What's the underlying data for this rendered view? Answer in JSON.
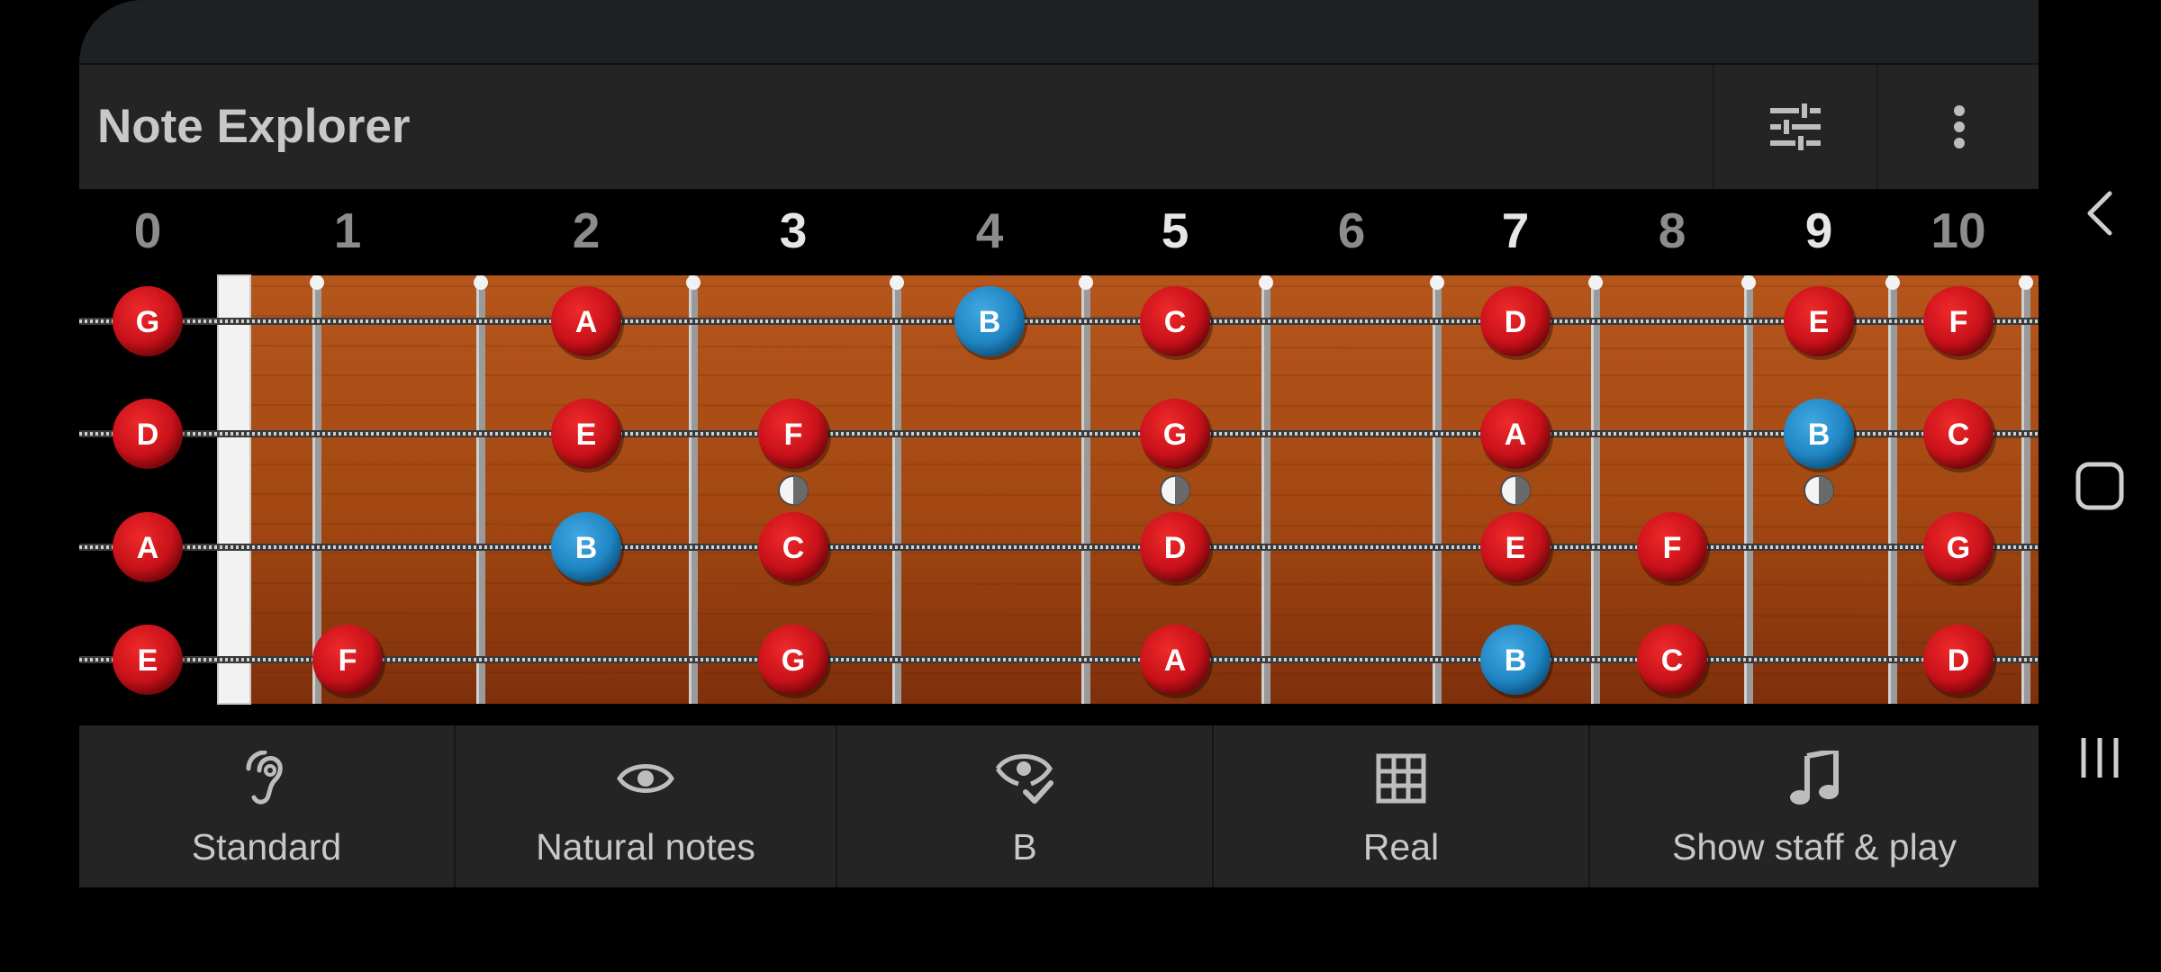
{
  "app": {
    "title": "Note Explorer",
    "icons": {
      "filter": "sliders-icon",
      "more": "more-vertical-icon"
    }
  },
  "fretboard": {
    "fret_numbers": [
      {
        "label": "0",
        "inlay": false
      },
      {
        "label": "1",
        "inlay": false
      },
      {
        "label": "2",
        "inlay": false
      },
      {
        "label": "3",
        "inlay": true
      },
      {
        "label": "4",
        "inlay": false
      },
      {
        "label": "5",
        "inlay": true
      },
      {
        "label": "6",
        "inlay": false
      },
      {
        "label": "7",
        "inlay": true
      },
      {
        "label": "8",
        "inlay": false
      },
      {
        "label": "9",
        "inlay": true
      },
      {
        "label": "10",
        "inlay": false
      }
    ],
    "inlay_frets": [
      3,
      5,
      7,
      9
    ],
    "strings": [
      {
        "open": "G",
        "notes": [
          {
            "fret": 0,
            "note": "G"
          },
          {
            "fret": 2,
            "note": "A"
          },
          {
            "fret": 4,
            "note": "B"
          },
          {
            "fret": 5,
            "note": "C"
          },
          {
            "fret": 7,
            "note": "D"
          },
          {
            "fret": 9,
            "note": "E"
          },
          {
            "fret": 10,
            "note": "F"
          }
        ]
      },
      {
        "open": "D",
        "notes": [
          {
            "fret": 0,
            "note": "D"
          },
          {
            "fret": 2,
            "note": "E"
          },
          {
            "fret": 3,
            "note": "F"
          },
          {
            "fret": 5,
            "note": "G"
          },
          {
            "fret": 7,
            "note": "A"
          },
          {
            "fret": 9,
            "note": "B"
          },
          {
            "fret": 10,
            "note": "C"
          }
        ]
      },
      {
        "open": "A",
        "notes": [
          {
            "fret": 0,
            "note": "A"
          },
          {
            "fret": 2,
            "note": "B"
          },
          {
            "fret": 3,
            "note": "C"
          },
          {
            "fret": 5,
            "note": "D"
          },
          {
            "fret": 7,
            "note": "E"
          },
          {
            "fret": 8,
            "note": "F"
          },
          {
            "fret": 10,
            "note": "G"
          }
        ]
      },
      {
        "open": "E",
        "notes": [
          {
            "fret": 0,
            "note": "E"
          },
          {
            "fret": 1,
            "note": "F"
          },
          {
            "fret": 3,
            "note": "G"
          },
          {
            "fret": 5,
            "note": "A"
          },
          {
            "fret": 7,
            "note": "B"
          },
          {
            "fret": 8,
            "note": "C"
          },
          {
            "fret": 10,
            "note": "D"
          }
        ]
      }
    ],
    "highlight_note": "B",
    "colors": {
      "note": "#c8111a",
      "highlight": "#1f86c4",
      "wood_light": "#b5561c",
      "wood_dark": "#7e2f0b",
      "fret": "#9a9a9a",
      "nut": "#f2f2f2"
    }
  },
  "toolbar": {
    "items": [
      {
        "label": "Standard",
        "icon": "hearing-icon"
      },
      {
        "label": "Natural notes",
        "icon": "eye-icon"
      },
      {
        "label": "B",
        "icon": "eye-check-icon"
      },
      {
        "label": "Real",
        "icon": "grid-icon"
      },
      {
        "label": "Show staff & play",
        "icon": "music-note-icon"
      }
    ]
  },
  "navbar": {
    "icons": [
      "back-icon",
      "home-icon",
      "recents-icon"
    ]
  }
}
